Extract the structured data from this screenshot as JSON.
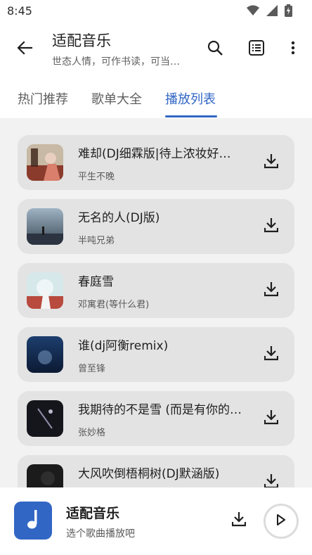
{
  "status_bar": {
    "time": "8:45",
    "icons": [
      "wifi-icon",
      "signal-icon",
      "battery-charging-icon"
    ]
  },
  "app_bar": {
    "title": "适配音乐",
    "subtitle": "世态人情，可作书读，可当…",
    "actions": [
      "back-arrow-icon",
      "search-icon",
      "list-icon",
      "more-vert-icon"
    ]
  },
  "tabs": [
    {
      "label": "热门推荐",
      "active": false
    },
    {
      "label": "歌单大全",
      "active": false
    },
    {
      "label": "播放列表",
      "active": true
    }
  ],
  "accent_color": "#3166c4",
  "songs": [
    {
      "title": "难却(DJ细霖版|待上浓妆好…",
      "artist": "平生不晚"
    },
    {
      "title": "无名的人(DJ版)",
      "artist": "半吨兄弟"
    },
    {
      "title": "春庭雪",
      "artist": "邓寓君(等什么君)"
    },
    {
      "title": "谁(dj阿衡remix)",
      "artist": "曾至锋"
    },
    {
      "title": "我期待的不是雪 (而是有你的…",
      "artist": "张妙格"
    },
    {
      "title": "大风吹倒梧桐树(DJ默涵版)",
      "artist": ""
    }
  ],
  "player": {
    "title": "适配音乐",
    "subtitle": "选个歌曲播放吧"
  }
}
